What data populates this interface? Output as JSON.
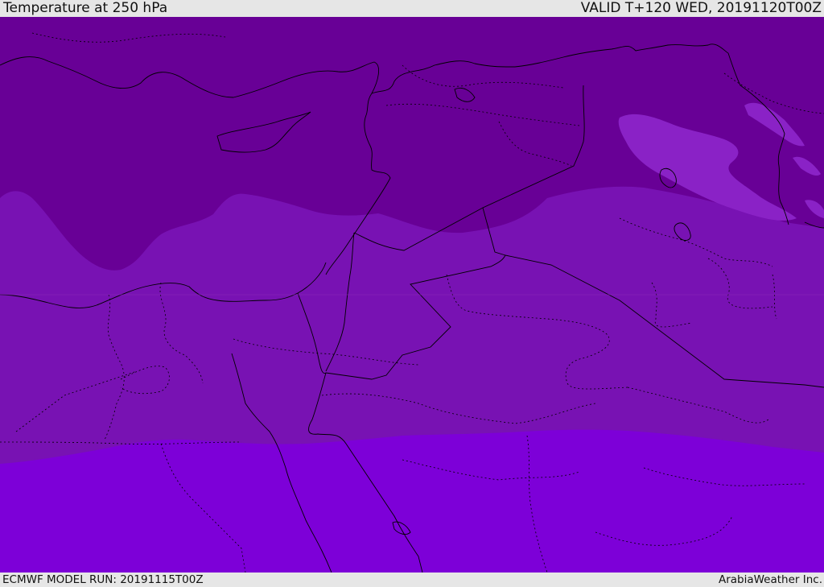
{
  "header": {
    "title": "Temperature at 250 hPa",
    "valid": "VALID T+120 WED, 20191120T00Z"
  },
  "footer": {
    "model_run": "ECMWF MODEL RUN: 20191115T00Z",
    "credit": "ArabiaWeather Inc."
  },
  "map": {
    "variable": "temperature",
    "level": "250 hPa",
    "colors": {
      "band_cold": "#680096",
      "band_mid": "#7812b3",
      "band_warm": "#7d00d8",
      "band_pale": "#8a22c6",
      "borders": "#000000"
    }
  }
}
